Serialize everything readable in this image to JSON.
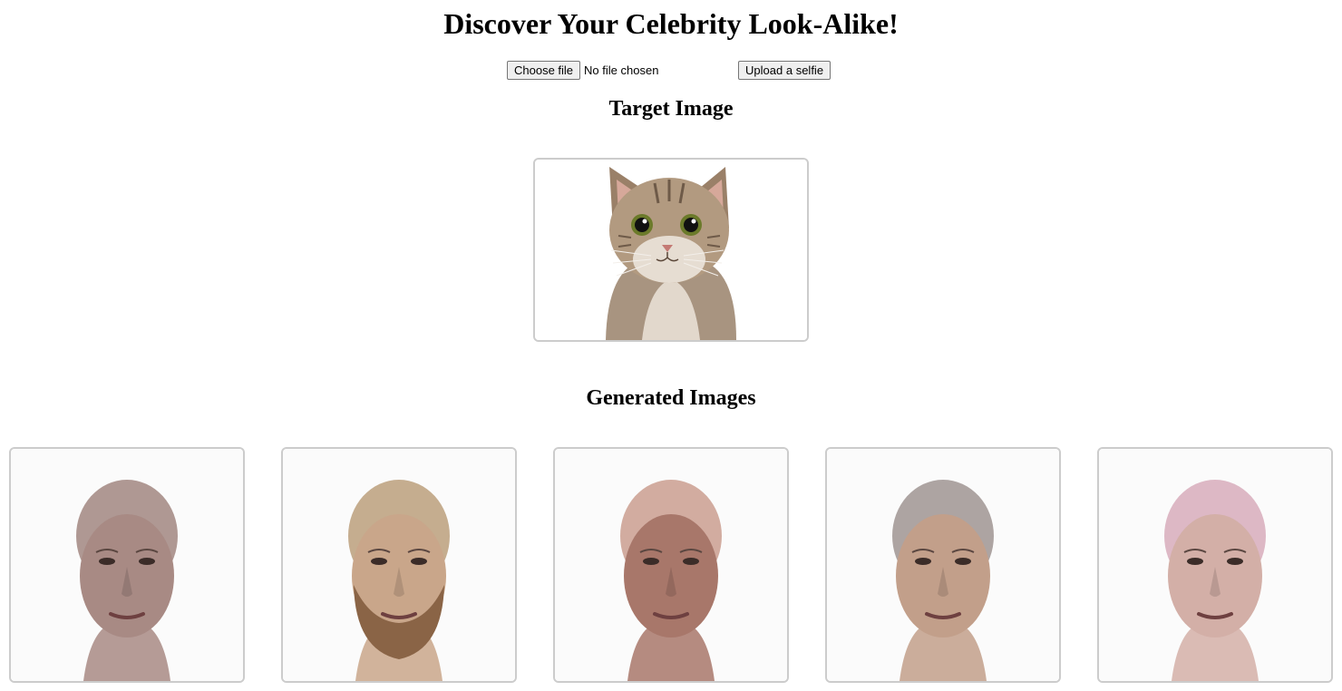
{
  "page": {
    "title": "Discover Your Celebrity Look-Alike!"
  },
  "upload": {
    "choose_file_label": "Choose file",
    "file_status": "No file chosen",
    "upload_button_label": "Upload a selfie"
  },
  "target": {
    "heading": "Target Image",
    "image_subject": "cat"
  },
  "generated": {
    "heading": "Generated Images",
    "images": [
      {
        "skin": "#a88a84",
        "hair": "#9c8079",
        "beard": false
      },
      {
        "skin": "#c9a68a",
        "hair": "#b89a74",
        "beard": true
      },
      {
        "skin": "#a8776a",
        "hair": "#c8998a",
        "beard": false
      },
      {
        "skin": "#c29f8a",
        "hair": "#9a8f8c",
        "beard": false
      },
      {
        "skin": "#d3afa7",
        "hair": "#d6a7b8",
        "beard": false
      }
    ]
  },
  "colors": {
    "border": "#cccccc",
    "background": "#ffffff"
  }
}
